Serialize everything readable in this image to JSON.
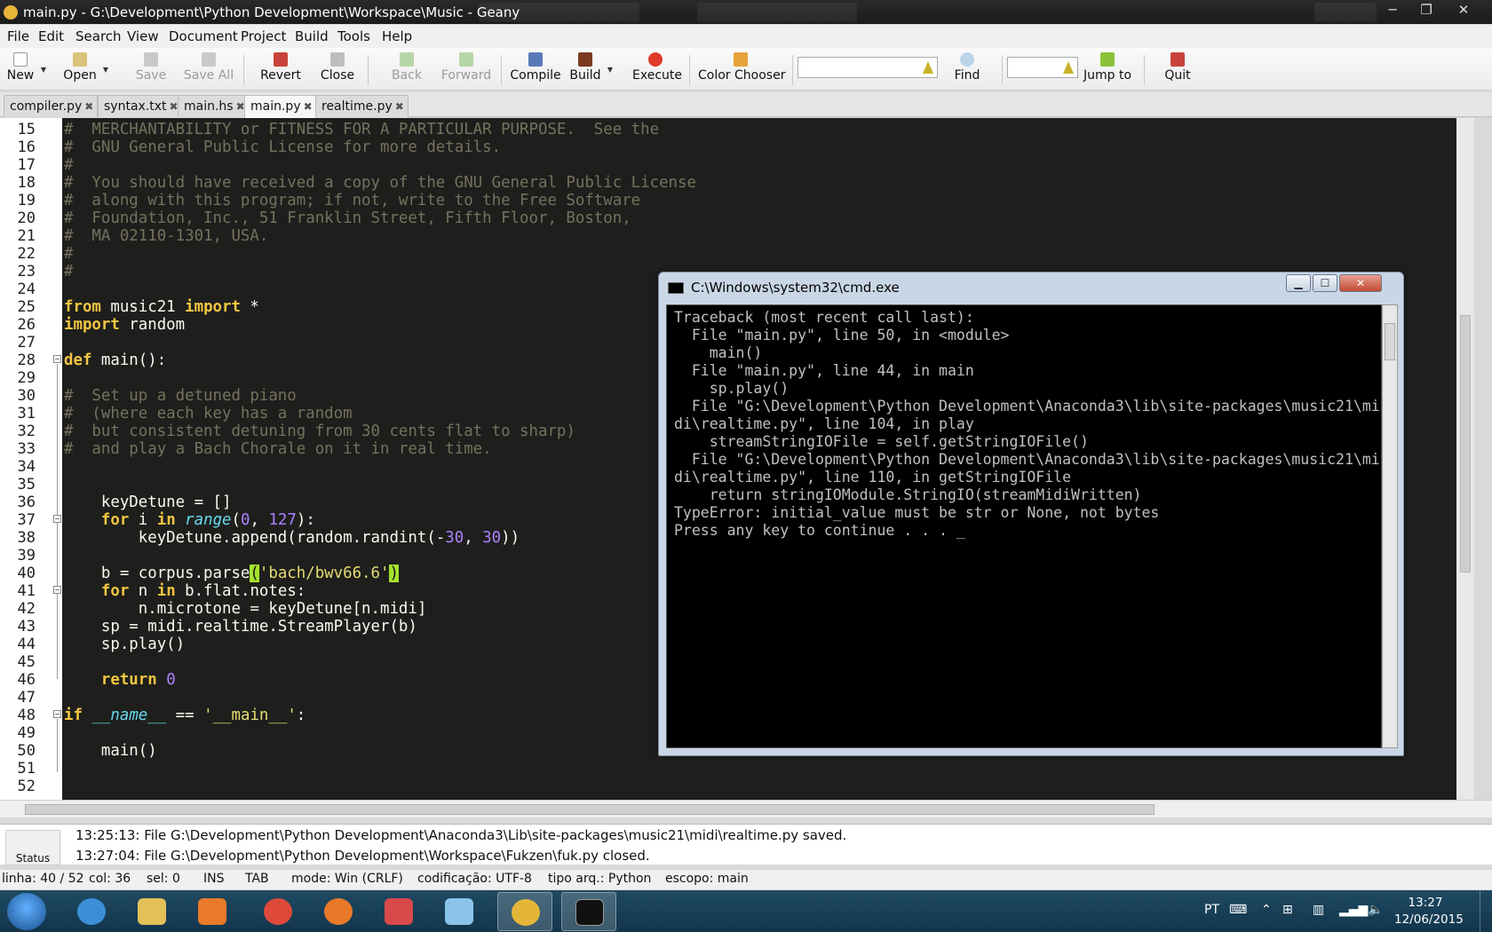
{
  "window": {
    "title": "main.py - G:\\Development\\Python Development\\Workspace\\Music - Geany"
  },
  "menu": [
    "File",
    "Edit",
    "Search",
    "View",
    "Document",
    "Project",
    "Build",
    "Tools",
    "Help"
  ],
  "toolbar": {
    "new": "New",
    "open": "Open",
    "save": "Save",
    "save_all": "Save All",
    "revert": "Revert",
    "close": "Close",
    "back": "Back",
    "forward": "Forward",
    "compile": "Compile",
    "build": "Build",
    "execute": "Execute",
    "color_chooser": "Color Chooser",
    "find": "Find",
    "jump_to": "Jump to",
    "quit": "Quit"
  },
  "tabs": [
    {
      "label": "compiler.py"
    },
    {
      "label": "syntax.txt"
    },
    {
      "label": "main.hs"
    },
    {
      "label": "main.py"
    },
    {
      "label": "realtime.py"
    }
  ],
  "editor": {
    "line_numbers": [
      "15",
      "16",
      "17",
      "18",
      "19",
      "20",
      "21",
      "22",
      "23",
      "24",
      "25",
      "26",
      "27",
      "28",
      "29",
      "30",
      "31",
      "32",
      "33",
      "34",
      "35",
      "36",
      "37",
      "38",
      "39",
      "40",
      "41",
      "42",
      "43",
      "44",
      "45",
      "46",
      "47",
      "48",
      "49",
      "50",
      "51",
      "52"
    ]
  },
  "messages": [
    "13:25:13: File G:\\Development\\Python Development\\Anaconda3\\Lib\\site-packages\\music21\\midi\\realtime.py saved.",
    "13:27:04: File G:\\Development\\Python Development\\Workspace\\Fukzen\\fuk.py closed."
  ],
  "message_tab": "Status",
  "status": {
    "line": "linha: 40 / 52",
    "col": "col: 36",
    "sel": "sel: 0",
    "ins": "INS",
    "tab": "TAB",
    "mode": "mode: Win (CRLF)",
    "encoding": "codificação: UTF-8",
    "filetype": "tipo arq.: Python",
    "scope": "escopo: main"
  },
  "cmd": {
    "title": "C:\\Windows\\system32\\cmd.exe",
    "lines": [
      "Traceback (most recent call last):",
      "  File \"main.py\", line 50, in <module>",
      "    main()",
      "  File \"main.py\", line 44, in main",
      "    sp.play()",
      "  File \"G:\\Development\\Python Development\\Anaconda3\\lib\\site-packages\\music21\\mi",
      "di\\realtime.py\", line 104, in play",
      "    streamStringIOFile = self.getStringIOFile()",
      "  File \"G:\\Development\\Python Development\\Anaconda3\\lib\\site-packages\\music21\\mi",
      "di\\realtime.py\", line 110, in getStringIOFile",
      "    return stringIOModule.StringIO(streamMidiWritten)",
      "TypeError: initial_value must be str or None, not bytes",
      "Press any key to continue . . . _"
    ]
  },
  "taskbar": {
    "lang": "PT",
    "time": "13:27",
    "date": "12/06/2015"
  },
  "icons": {
    "app": "geany-icon",
    "cmd": "console-icon"
  },
  "colors": {
    "editor_bg": "#1e1f1c",
    "keyword": "#f4c542",
    "comment": "#75715e",
    "string": "#e6db74"
  }
}
